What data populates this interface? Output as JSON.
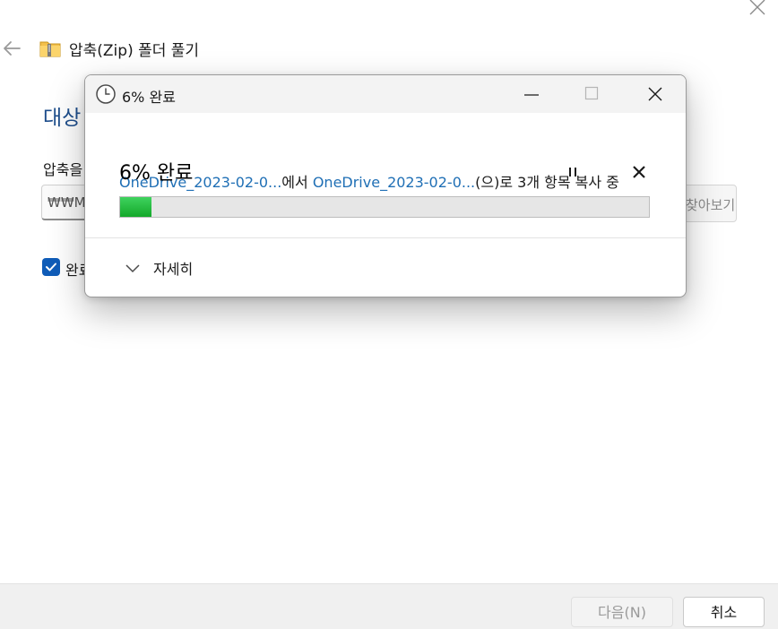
{
  "wizard": {
    "title": "압축(Zip) 폴더 풀기",
    "heading": "대상",
    "path_label": "압축을",
    "path_value": "₩₩M",
    "browse_label": "찾아보기(R)...",
    "show_label": "완료",
    "show_checked": true,
    "next_label": "다음(N)",
    "cancel_label": "취소"
  },
  "dialog": {
    "title": "6% 완료",
    "source_name": "OneDrive_2023-02-0...",
    "from_text": "에서 ",
    "dest_name": "OneDrive_2023-02-0...",
    "to_text": "(으)로 3개 항목 복사 중",
    "percent_text": "6% 완료",
    "progress": 0.06,
    "details_label": "자세히"
  },
  "colors": {
    "link": "#1f6fb5",
    "progress_fill": "#14a82a",
    "heading": "#1e4e8c",
    "checkbox": "#0f5cb8"
  },
  "icons": {
    "back": "arrow-left-icon",
    "zip": "zip-folder-icon",
    "clock": "clock-icon",
    "pause": "pause-icon",
    "cancel": "close-icon",
    "chevron": "chevron-down-icon"
  }
}
